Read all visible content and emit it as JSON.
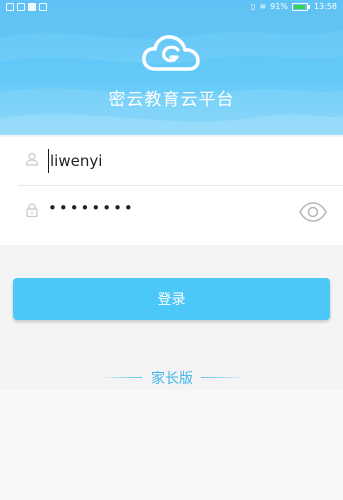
{
  "status_bar": {
    "battery_percent": "91%",
    "time": "13:58",
    "icons": [
      "notification-icon",
      "notification-icon",
      "heart-icon",
      "shield-icon",
      "vibrate-icon",
      "wifi-icon",
      "battery-icon"
    ]
  },
  "header": {
    "logo_icon": "cloud-icon",
    "app_title": "密云教育云平台",
    "background_color": "#5fc6f7"
  },
  "login_form": {
    "username": {
      "icon": "user-icon",
      "value": "liwenyi"
    },
    "password": {
      "icon": "lock-icon",
      "value": "••••••••",
      "toggle_icon": "eye-icon"
    }
  },
  "login_button": {
    "label": "登录",
    "color": "#4cc8f8"
  },
  "edition": {
    "label": "家长版",
    "color": "#3fb6ec"
  }
}
